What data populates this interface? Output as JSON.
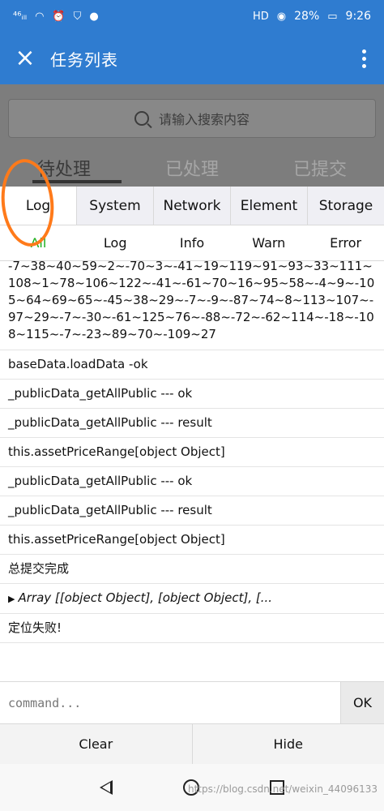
{
  "status_bar": {
    "signal": "⁴⁶ᵢₗₗ",
    "hd": "HD",
    "battery": "28%",
    "time": "9:26"
  },
  "app_bar": {
    "close_icon": "×",
    "title": "任务列表"
  },
  "background_page": {
    "search_placeholder": "请输入搜索内容",
    "tabs": [
      "待处理",
      "已处理",
      "已提交"
    ]
  },
  "console": {
    "tabs": [
      "Log",
      "System",
      "Network",
      "Element",
      "Storage"
    ],
    "active_tab": "Log",
    "filters": [
      "All",
      "Log",
      "Info",
      "Warn",
      "Error"
    ],
    "logs": [
      "-7~38~40~59~2~-70~3~-41~19~119~91~93~33~111~108~1~78~106~122~-41~-61~70~16~95~58~-4~9~-105~64~69~65~-45~38~29~-7~-9~-87~74~8~113~107~-97~29~-7~-30~-61~125~76~-88~-72~-62~114~-18~-108~115~-7~-23~89~70~-109~27",
      "baseData.loadData -ok",
      "_publicData_getAllPublic --- ok",
      "_publicData_getAllPublic --- result",
      "this.assetPriceRange[object Object]",
      "_publicData_getAllPublic --- ok",
      "_publicData_getAllPublic --- result",
      "this.assetPriceRange[object Object]",
      "总提交完成",
      "Array [[object Object], [object Object], [...",
      "定位失败!"
    ],
    "command_placeholder": "command...",
    "ok_label": "OK",
    "clear_label": "Clear",
    "hide_label": "Hide"
  },
  "watermark": "https://blog.csdn.net/weixin_44096133"
}
